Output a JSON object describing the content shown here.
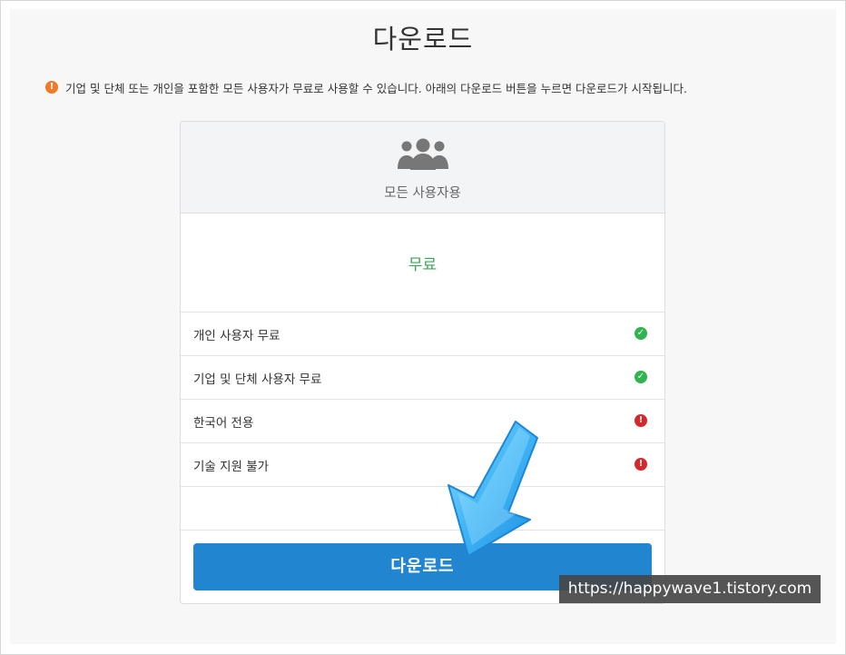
{
  "page": {
    "title": "다운로드"
  },
  "notice": {
    "icon": "exclamation-circle-icon",
    "icon_glyph": "!",
    "text": "기업 및 단체 또는 개인을 포함한 모든 사용자가 무료로 사용할 수 있습니다. 아래의 다운로드 버튼을 누르면 다운로드가 시작됩니다.",
    "icon_color": "#ef7a28"
  },
  "card": {
    "header_icon": "users-icon",
    "plan_name": "모든 사용자용",
    "price": "무료",
    "price_color": "#3aa655",
    "features": [
      {
        "label": "개인 사용자 무료",
        "status": "check",
        "glyph": "✓",
        "icon": "check-circle-icon"
      },
      {
        "label": "기업 및 단체 사용자 무료",
        "status": "check",
        "glyph": "✓",
        "icon": "check-circle-icon"
      },
      {
        "label": "한국어 전용",
        "status": "warn",
        "glyph": "!",
        "icon": "exclamation-circle-icon"
      },
      {
        "label": "기술 지원 불가",
        "status": "warn",
        "glyph": "!",
        "icon": "exclamation-circle-icon"
      }
    ],
    "download_label": "다운로드",
    "button_color": "#2185d0"
  },
  "overlay": {
    "arrow_icon": "blue-arrow-icon",
    "watermark_text": "https://happywave1.tistory.com"
  }
}
